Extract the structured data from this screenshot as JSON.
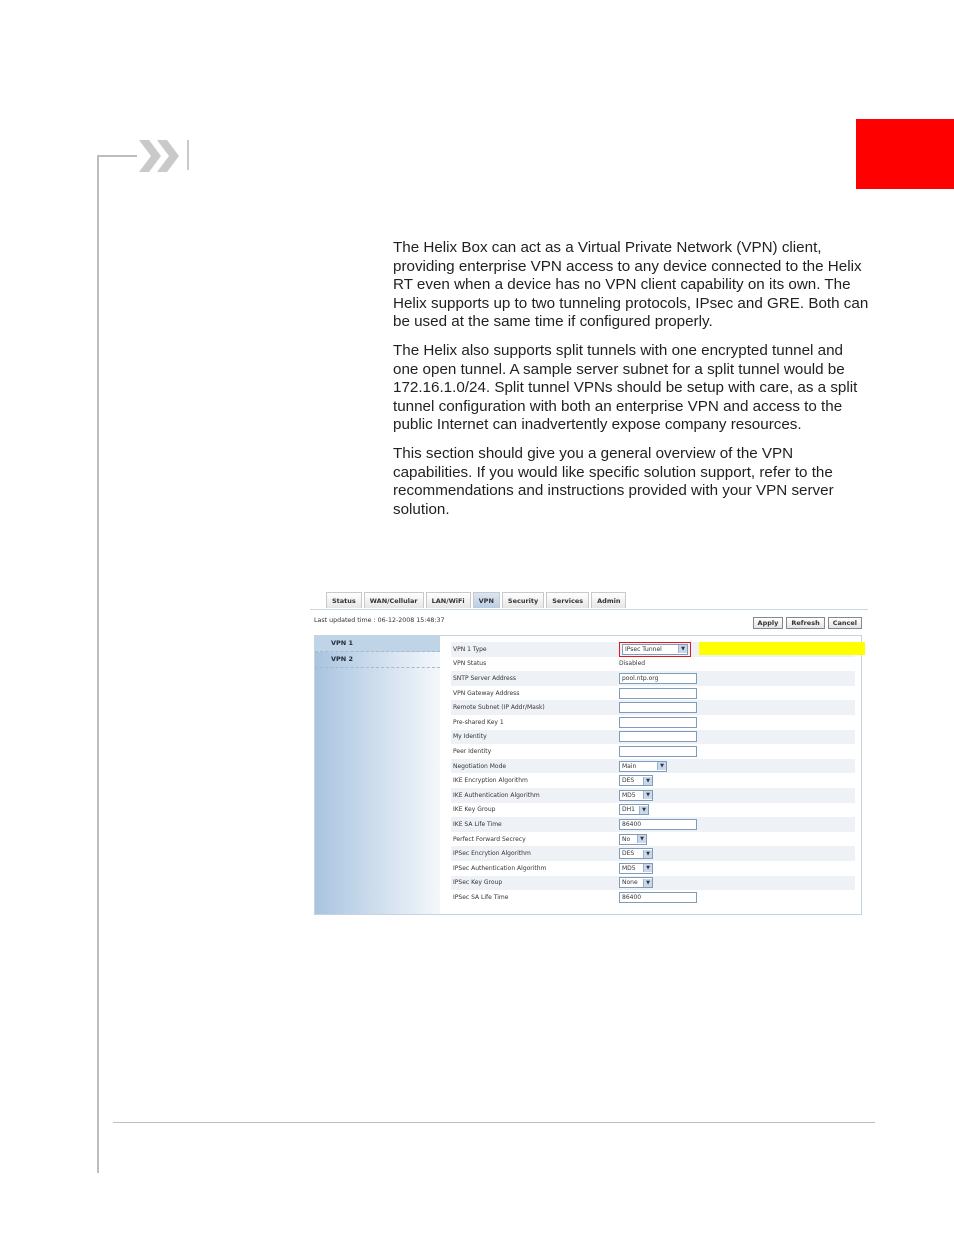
{
  "paragraphs": [
    "The Helix Box can act as a Virtual Private Network (VPN) client, providing enterprise VPN access to any device connected to the Helix RT even when a device has no VPN client capability on its own. The Helix supports up to two tunneling protocols, IPsec and GRE. Both can be used at the same time if configured properly.",
    "The Helix also supports split tunnels with one encrypted tunnel and one open tunnel. A sample server subnet for a split tunnel would be 172.16.1.0/24. Split tunnel VPNs should be setup with care, as a split tunnel configuration with both an enterprise VPN and access to the public Internet can inadvertently expose company resources.",
    "This section should give you a general overview of the VPN capabilities.  If you would like specific solution support, refer to the recommendations and instructions provided with your VPN server solution."
  ],
  "screenshot": {
    "tabs": [
      "Status",
      "WAN/Cellular",
      "LAN/WiFi",
      "VPN",
      "Security",
      "Services",
      "Admin"
    ],
    "active_tab": "VPN",
    "last_updated": "Last updated time : 06-12-2008 15:48:37",
    "buttons": {
      "apply": "Apply",
      "refresh": "Refresh",
      "cancel": "Cancel"
    },
    "sidebar": [
      "VPN 1",
      "VPN 2"
    ],
    "fields": [
      {
        "label": "VPN 1 Type",
        "value": "IPsec Tunnel"
      },
      {
        "label": "VPN Status",
        "value": "Disabled"
      },
      {
        "label": "SNTP Server Address",
        "value": "pool.ntp.org"
      },
      {
        "label": "VPN Gateway Address",
        "value": ""
      },
      {
        "label": "Remote Subnet (IP Addr/Mask)",
        "value": ""
      },
      {
        "label": "Pre-shared Key 1",
        "value": ""
      },
      {
        "label": "My Identity",
        "value": ""
      },
      {
        "label": "Peer Identity",
        "value": ""
      },
      {
        "label": "Negotiation Mode",
        "value": "Main"
      },
      {
        "label": "IKE Encryption Algorithm",
        "value": "DES"
      },
      {
        "label": "IKE Authentication Algorithm",
        "value": "MD5"
      },
      {
        "label": "IKE Key Group",
        "value": "DH1"
      },
      {
        "label": "IKE SA Life Time",
        "value": "86400"
      },
      {
        "label": "Perfect Forward Secrecy",
        "value": "No"
      },
      {
        "label": "IPSec Encrytion Algorithm",
        "value": "DES"
      },
      {
        "label": "IPSec Authentication Algorithm",
        "value": "MD5"
      },
      {
        "label": "IPSec Key Group",
        "value": "None"
      },
      {
        "label": "IPSec SA Life Time",
        "value": "86400"
      }
    ]
  }
}
